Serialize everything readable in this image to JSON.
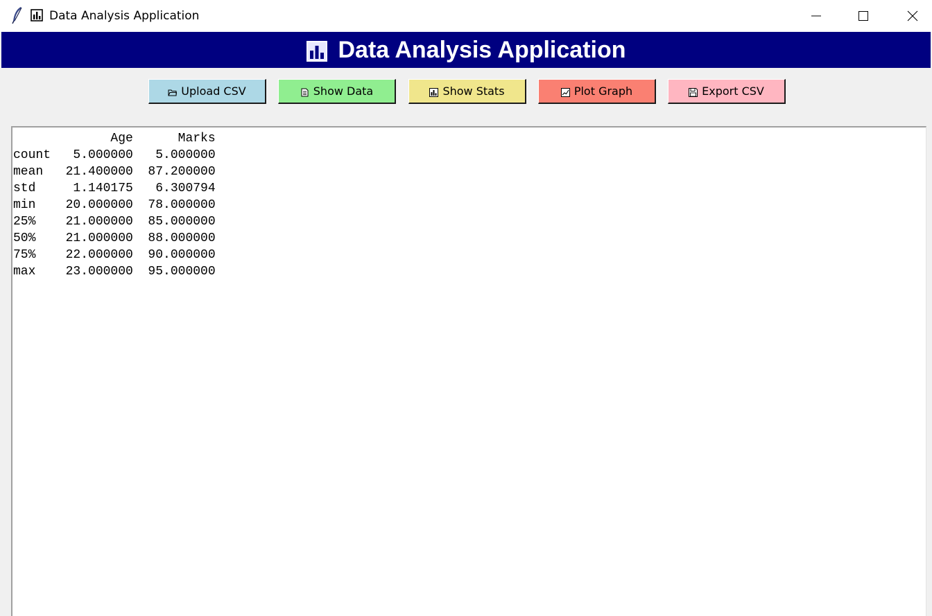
{
  "window": {
    "title": "Data Analysis Application",
    "app_icon": "feather-icon",
    "title_icon": "bar-chart-icon",
    "controls": [
      "minimize-icon",
      "maximize-icon",
      "close-icon"
    ]
  },
  "banner": {
    "title": "Data Analysis Application",
    "icon": "bar-chart-icon",
    "background": "#000080",
    "color": "#ffffff"
  },
  "toolbar": {
    "buttons": [
      {
        "label": "Upload CSV",
        "icon": "folder-icon",
        "color": "#add8e6"
      },
      {
        "label": "Show Data",
        "icon": "document-icon",
        "color": "#90ee90"
      },
      {
        "label": "Show Stats",
        "icon": "bar-chart-icon",
        "color": "#f0e68c"
      },
      {
        "label": "Plot Graph",
        "icon": "chart-trend-icon",
        "color": "#fa8072"
      },
      {
        "label": "Export CSV",
        "icon": "floppy-disk-icon",
        "color": "#ffb6c1"
      }
    ]
  },
  "output": {
    "text": "             Age      Marks\ncount   5.000000   5.000000\nmean   21.400000  87.200000\nstd     1.140175   6.300794\nmin    20.000000  78.000000\n25%    21.000000  85.000000\n50%    21.000000  88.000000\n75%    22.000000  90.000000\nmax    23.000000  95.000000"
  }
}
